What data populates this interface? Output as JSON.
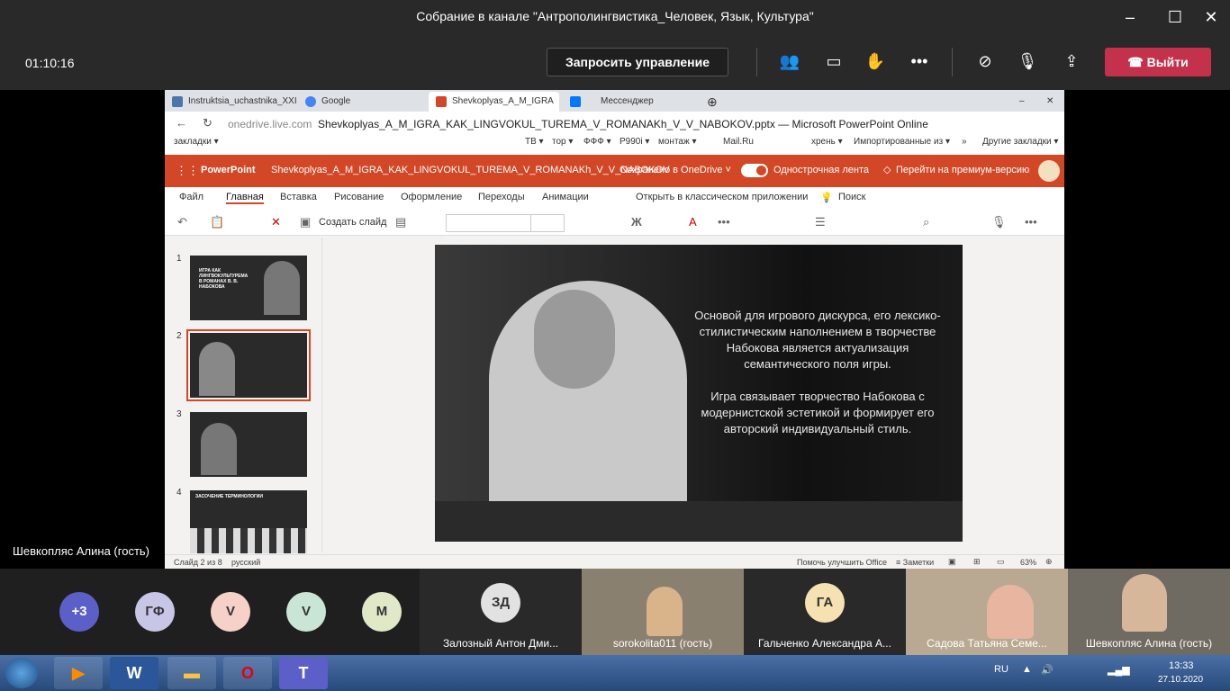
{
  "window": {
    "title": "Собрание в канале \"Антрополингвистика_Человек, Язык, Культура\""
  },
  "meeting": {
    "timer": "01:10:16",
    "request_control": "Запросить управление",
    "leave": "Выйти",
    "presenter_name": "Шевкопляс Алина (гость)"
  },
  "browser": {
    "tabs": [
      {
        "label": "Instruktsia_uchastnika_XXI"
      },
      {
        "label": "Google"
      },
      {
        "label": "Shevkoplyas_A_M_IGRA"
      },
      {
        "label": "Мессенджер"
      }
    ],
    "url_domain": "onedrive.live.com",
    "url_title": "Shevkoplyas_A_M_IGRA_KAK_LINGVOKUL_TUREMA_V_ROMANAKh_V_V_NABOKOV.pptx — Microsoft PowerPoint Online",
    "bookmarks": [
      "закладки ▾",
      "ТВ ▾",
      "тор ▾",
      "ФФФ ▾",
      "P990i ▾",
      "монтаж ▾",
      "Mail.Ru",
      "хрень ▾",
      "Импортированные из ▾",
      "»",
      "Другие закладки ▾"
    ]
  },
  "ppt": {
    "app": "PowerPoint",
    "filename": "Shevkoplyas_A_M_IGRA_KAK_LINGVOKUL_TUREMA_V_ROMANAKh_V_V_NABOKOV",
    "saved": "Сохранено в OneDrive ˅",
    "single_ribbon": "Однострочная лента",
    "premium": "Перейти на премиум-версию",
    "ribbon_tabs": [
      "Файл",
      "Главная",
      "Вставка",
      "Рисование",
      "Оформление",
      "Переходы",
      "Анимации"
    ],
    "open_desktop": "Открыть в классическом приложении",
    "search": "Поиск",
    "new_slide": "Создать слайд",
    "thumbs": [
      {
        "num": "1",
        "title": "ИГРА КАК ЛИНГВОКУЛЬТУРЕМА В РОМАНАХ В. В. НАБОКОВА"
      },
      {
        "num": "2",
        "title": ""
      },
      {
        "num": "3",
        "title": ""
      },
      {
        "num": "4",
        "title": "ЗАСОЧЕНИЕ ТЕРМИНОЛОГИИ"
      }
    ],
    "slide_text1": "Основой для игрового дискурса, его лексико-стилистическим наполнением в творчестве Набокова является актуализация семантического поля игры.",
    "slide_text2": "Игра связывает творчество Набокова с модернистской эстетикой и формирует его авторский индивидуальный стиль.",
    "status": {
      "slide": "Слайд 2 из 8",
      "lang": "русский",
      "help": "Помочь улучшить Office",
      "notes": "Заметки",
      "zoom": "63%"
    }
  },
  "participants": [
    {
      "initials": "+3",
      "color": "#5b5fc7"
    },
    {
      "initials": "ГФ",
      "color": "#c8c6e6"
    },
    {
      "initials": "V",
      "color": "#f6d1c8"
    },
    {
      "initials": "V",
      "color": "#c9e5d6"
    },
    {
      "initials": "M",
      "color": "#dfe9c8"
    }
  ],
  "tiles": [
    {
      "initials": "ЗД",
      "name": "Залозный Антон Дми..."
    },
    {
      "initials": "",
      "name": "sorokolita011 (гость)"
    },
    {
      "initials": "ГА",
      "name": "Гальченко Александра А..."
    },
    {
      "initials": "",
      "name": "Садова Татьяна Семе..."
    },
    {
      "initials": "",
      "name": "Шевкопляс Алина (гость)"
    }
  ],
  "taskbar": {
    "lang": "RU",
    "time": "13:33",
    "date": "27.10.2020"
  }
}
